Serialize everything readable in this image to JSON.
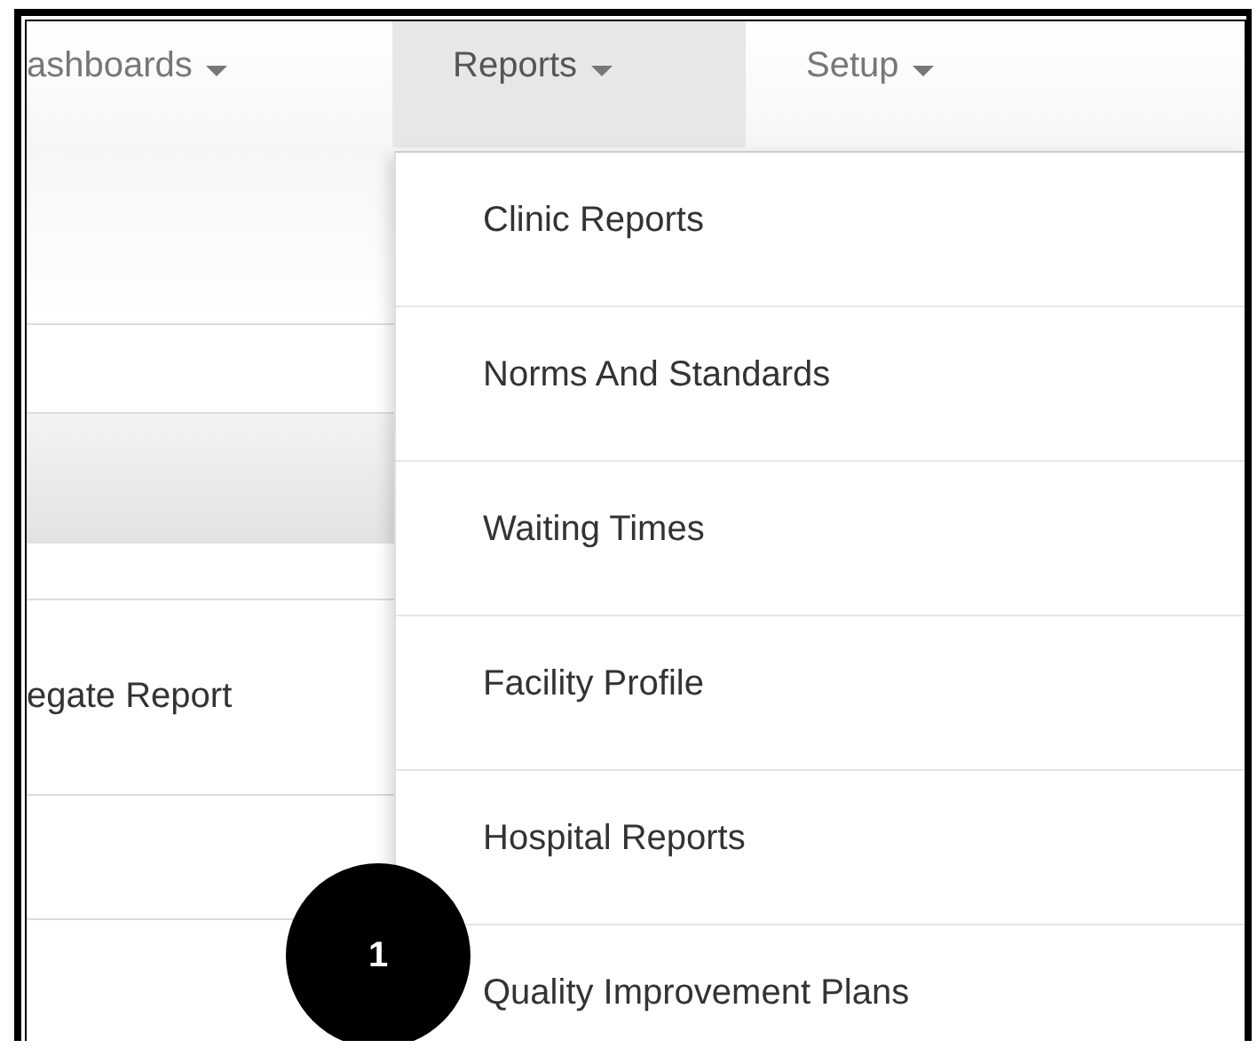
{
  "nav": [
    {
      "label": "ashboards",
      "selected": false
    },
    {
      "label": "Reports",
      "selected": true
    },
    {
      "label": "Setup",
      "selected": false
    }
  ],
  "page_text": "egate Report",
  "dropdown": [
    {
      "label": "Clinic Reports"
    },
    {
      "label": "Norms And Standards"
    },
    {
      "label": "Waiting Times"
    },
    {
      "label": "Facility Profile"
    },
    {
      "label": "Hospital Reports"
    },
    {
      "label": "Quality Improvement Plans"
    }
  ],
  "step_badge": "1"
}
